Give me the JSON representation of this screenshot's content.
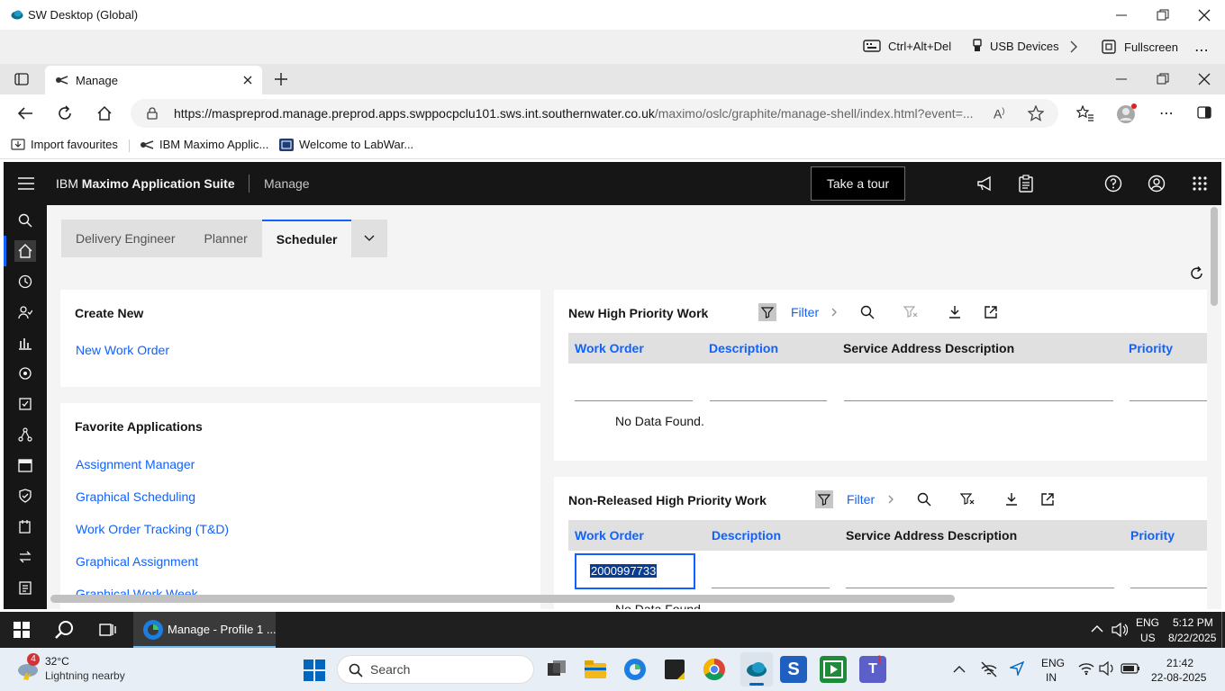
{
  "outer_window": {
    "title": "SW Desktop (Global)",
    "toolbar": {
      "ctrl_alt_del": "Ctrl+Alt+Del",
      "usb_devices": "USB Devices",
      "fullscreen": "Fullscreen"
    }
  },
  "browser": {
    "tab_title": "Manage",
    "url_host": "https://maspreprod.manage.preprod.apps.swppocpclu101.sws.int.southernwater.co.uk",
    "url_path": "/maximo/oslc/graphite/manage-shell/index.html?event=...",
    "favourites": [
      {
        "label": "Import favourites"
      },
      {
        "label": "IBM Maximo Applic..."
      },
      {
        "label": "Welcome to LabWar..."
      }
    ]
  },
  "app": {
    "brand_prefix": "IBM ",
    "brand_bold": "Maximo Application Suite",
    "module": "Manage",
    "tour_button": "Take a tour",
    "tabs": [
      {
        "label": "Delivery Engineer"
      },
      {
        "label": "Planner"
      },
      {
        "label": "Scheduler",
        "active": true
      }
    ],
    "create_new": {
      "title": "Create New",
      "links": [
        "New Work Order"
      ]
    },
    "favorites": {
      "title": "Favorite Applications",
      "links": [
        "Assignment Manager",
        "Graphical Scheduling",
        "Work Order Tracking (T&D)",
        "Graphical Assignment",
        "Graphical Work Week"
      ]
    },
    "high_priority": {
      "title": "New High Priority Work",
      "filter_label": "Filter",
      "columns": [
        "Work Order",
        "Description",
        "Service Address Description",
        "Priority"
      ],
      "empty_text": "No Data Found."
    },
    "non_released": {
      "title": "Non-Released High Priority Work",
      "filter_label": "Filter",
      "columns": [
        "Work Order",
        "Description",
        "Service Address Description",
        "Priority"
      ],
      "work_order_value": "2000997733",
      "empty_text": "No Data Found."
    }
  },
  "taskbar_remote": {
    "app_label": "Manage - Profile 1 ...",
    "lang_top": "ENG",
    "lang_bottom": "US",
    "time": "5:12 PM",
    "date": "8/22/2025"
  },
  "taskbar_local": {
    "weather_badge": "4",
    "temperature": "32°C",
    "weather_text": "Lightning nearby",
    "search_placeholder": "Search",
    "lang_top": "ENG",
    "lang_bottom": "IN",
    "time": "21:42",
    "date": "22-08-2025"
  },
  "colors": {
    "ibm_blue": "#0f62fe",
    "header_dark": "#161616",
    "taskbar_dark": "#1f1f1f"
  }
}
